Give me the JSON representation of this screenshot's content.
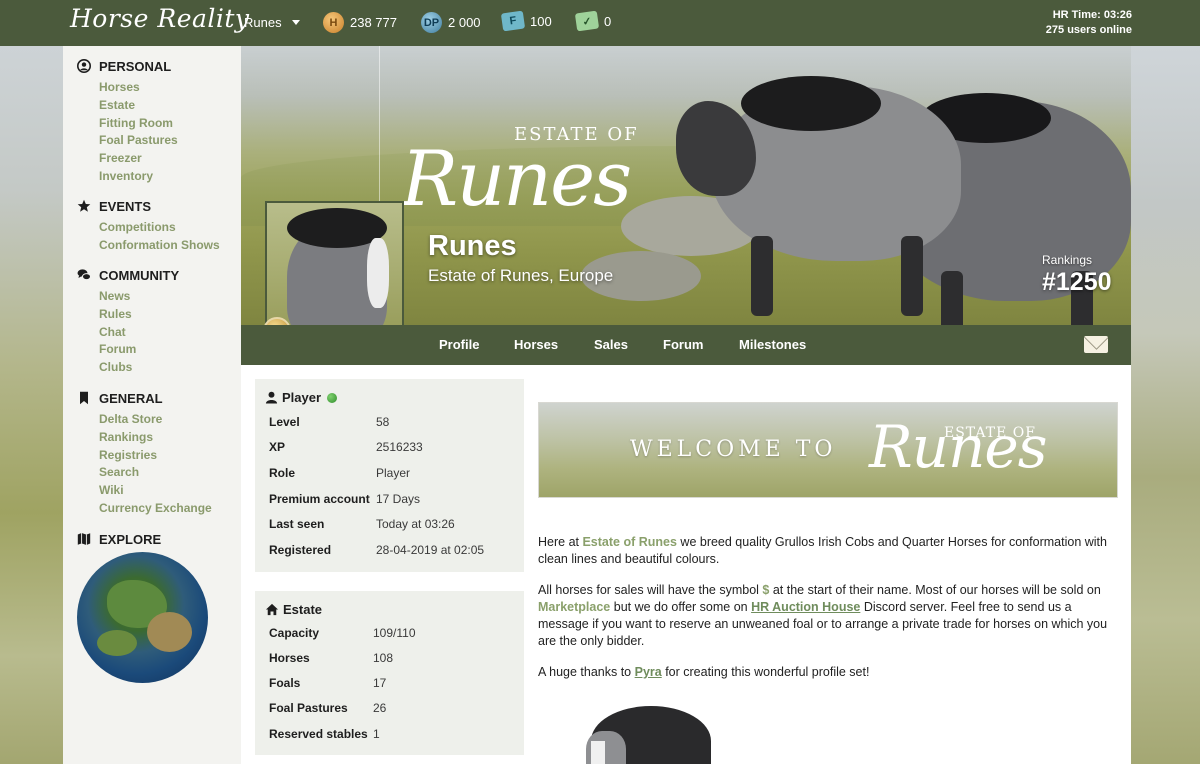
{
  "topbar": {
    "logo": "Horse Reality",
    "account": "Runes",
    "currencies": [
      {
        "icon": "coin-icon",
        "value": "238 777"
      },
      {
        "icon": "dp-icon",
        "value": "2 000"
      },
      {
        "icon": "ticket-icon",
        "value": "100"
      },
      {
        "icon": "green-ticket-icon",
        "value": "0"
      }
    ],
    "hr_time": "HR Time: 03:26",
    "users_online": "275 users online"
  },
  "sidebar": {
    "sections": [
      {
        "title": "PERSONAL",
        "icon": "person-icon",
        "items": [
          "Horses",
          "Estate",
          "Fitting Room",
          "Foal Pastures",
          "Freezer",
          "Inventory"
        ]
      },
      {
        "title": "EVENTS",
        "icon": "star-icon",
        "items": [
          "Competitions",
          "Conformation Shows"
        ]
      },
      {
        "title": "COMMUNITY",
        "icon": "chat-icon",
        "items": [
          "News",
          "Rules",
          "Chat",
          "Forum",
          "Clubs"
        ]
      },
      {
        "title": "GENERAL",
        "icon": "bookmark-icon",
        "items": [
          "Delta Store",
          "Rankings",
          "Registries",
          "Search",
          "Wiki",
          "Currency Exchange"
        ]
      },
      {
        "title": "EXPLORE",
        "icon": "map-icon",
        "items": []
      }
    ]
  },
  "banner": {
    "estate_of": "ESTATE OF",
    "script_title": "Runes",
    "player_name": "Runes",
    "player_sub": "Estate of Runes, Europe",
    "rankings_label": "Rankings",
    "rankings_value": "#1250"
  },
  "tabs": [
    "Profile",
    "Horses",
    "Sales",
    "Forum",
    "Milestones"
  ],
  "player_panel": {
    "title": "Player",
    "rows": [
      {
        "label": "Level",
        "value": "58"
      },
      {
        "label": "XP",
        "value": "2516233"
      },
      {
        "label": "Role",
        "value": "Player"
      },
      {
        "label": "Premium account",
        "value": "17 Days"
      },
      {
        "label": "Last seen",
        "value": "Today at 03:26"
      },
      {
        "label": "Registered",
        "value": "28-04-2019 at 02:05"
      }
    ]
  },
  "estate_panel": {
    "title": "Estate",
    "rows": [
      {
        "label": "Capacity",
        "value": "109/110"
      },
      {
        "label": "Horses",
        "value": "108"
      },
      {
        "label": "Foals",
        "value": "17"
      },
      {
        "label": "Foal Pastures",
        "value": "26"
      },
      {
        "label": "Reserved stables",
        "value": "1"
      }
    ]
  },
  "welcome": {
    "welcome_to": "WELCOME TO",
    "estate_of": "ESTATE OF",
    "script": "Runes"
  },
  "content": {
    "p1_pre": "Here at ",
    "p1_hl": "Estate of Runes",
    "p1_post": " we breed quality Grullos Irish Cobs and Quarter Horses for conformation with clean lines and beautiful colours.",
    "p2_a": "All horses for sales will have the symbol ",
    "p2_symbol": "$",
    "p2_b": " at the start of their name. Most of our horses will be sold on ",
    "p2_marketplace": "Marketplace",
    "p2_c": " but we do offer some on ",
    "p2_auction": "HR Auction House",
    "p2_d": " Discord server. Feel free to send us a message if you want to reserve an unweaned foal or to arrange a private trade for horses on which you are the only bidder.",
    "p3_a": "A huge thanks to ",
    "p3_link": "Pyra",
    "p3_b": " for creating this wonderful profile set!"
  },
  "colors": {
    "nav": "#4b5a3c",
    "sidebar_link": "#8a9a6c",
    "panel_bg": "#eef0eb"
  }
}
